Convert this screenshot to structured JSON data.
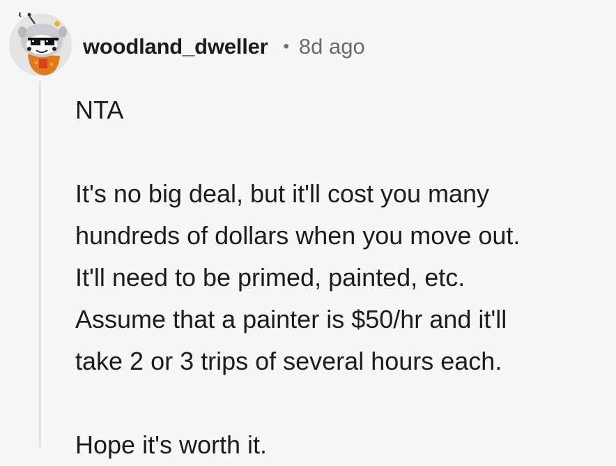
{
  "comment": {
    "author": "woodland_dweller",
    "separator": "•",
    "timestamp": "8d ago",
    "avatar_icon": "snoo-avatar-with-pixel-sunglasses-icon",
    "body": {
      "line1": "NTA",
      "para2": [
        "It's no big deal, but it'll cost you many",
        "hundreds of dollars when you move out.",
        "It'll need to be primed, painted, etc.",
        "Assume that a painter is $50/hr and it'll",
        "take 2 or 3 trips of several hours each."
      ],
      "line3": "Hope it's worth it."
    }
  },
  "colors": {
    "background": "#f7f7f7",
    "text": "#1c1c1c",
    "meta": "#6b6b6b",
    "thread_line": "#e2e2e2"
  }
}
